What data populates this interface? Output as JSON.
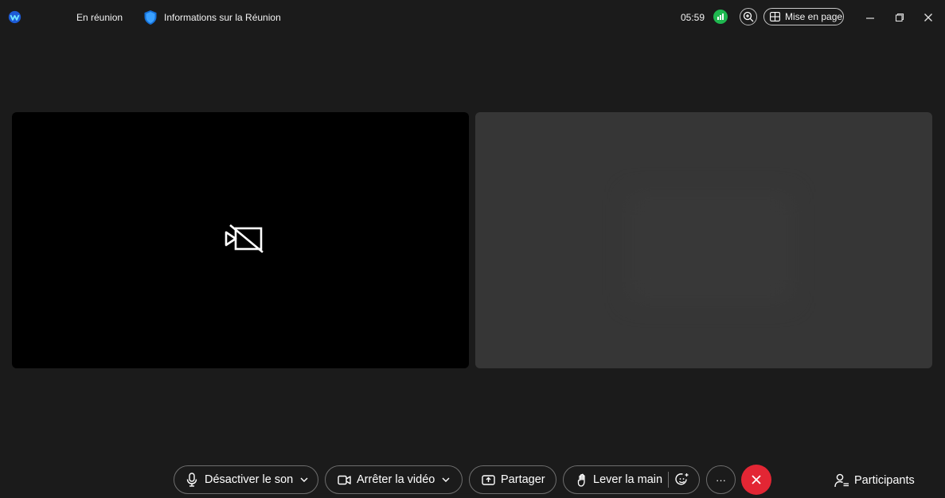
{
  "titlebar": {
    "meeting_status": "En réunion",
    "meeting_info_label": "Informations sur la Réunion",
    "timer": "05:59",
    "layout_label": "Mise en page"
  },
  "controls": {
    "mute_label": "Désactiver le son",
    "video_label": "Arrêter la vidéo",
    "share_label": "Partager",
    "raise_hand_label": "Lever la main",
    "more_label": "···",
    "participants_label": "Participants"
  },
  "icons": {
    "app_logo": "webex-logo-icon",
    "meeting_info": "shield-icon",
    "network": "network-signal-icon",
    "zoom": "zoom-in-icon",
    "layout": "grid-layout-icon",
    "video_off": "video-off-icon",
    "mic": "microphone-icon",
    "camera": "camera-icon",
    "share": "share-screen-icon",
    "hand": "raise-hand-icon",
    "reaction": "emoji-reaction-icon",
    "leave": "close-icon",
    "participants": "participants-icon"
  },
  "colors": {
    "background": "#1b1b1b",
    "leave_button": "#e32634",
    "network_indicator": "#1fb74f",
    "self_tile": "#000000",
    "remote_tile": "#363636"
  }
}
